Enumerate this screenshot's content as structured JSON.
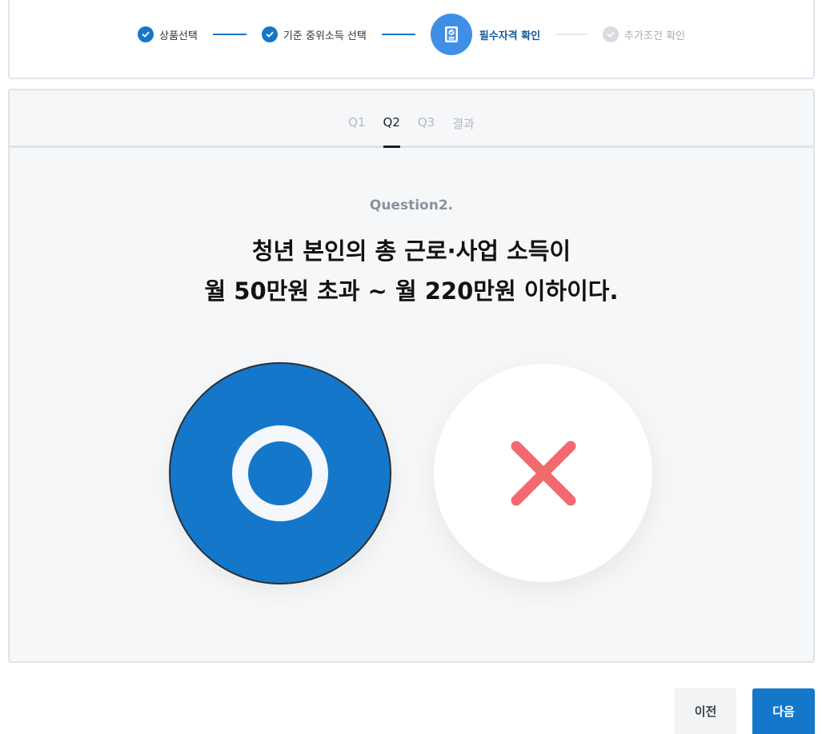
{
  "steps": [
    {
      "label": "상품선택",
      "state": "done"
    },
    {
      "label": "기준 중위소득 선택",
      "state": "done"
    },
    {
      "label": "필수자격 확인",
      "state": "current"
    },
    {
      "label": "추가조건 확인",
      "state": "pending"
    }
  ],
  "tabs": [
    {
      "label": "Q1",
      "active": false
    },
    {
      "label": "Q2",
      "active": true
    },
    {
      "label": "Q3",
      "active": false
    },
    {
      "label": "결과",
      "active": false
    }
  ],
  "question": {
    "number": "Question2.",
    "line1": "청년 본인의 총 근로·사업 소득이",
    "line2": "월 50만원 초과 ~ 월 220만원 이하이다."
  },
  "answers": {
    "yes_icon": "circle-o-icon",
    "no_icon": "x-mark-icon",
    "selected": "yes"
  },
  "buttons": {
    "prev": "이전",
    "next": "다음"
  },
  "colors": {
    "primary": "#1577c9",
    "current_step": "#3f8fe6",
    "no_mark": "#f26a6e"
  }
}
